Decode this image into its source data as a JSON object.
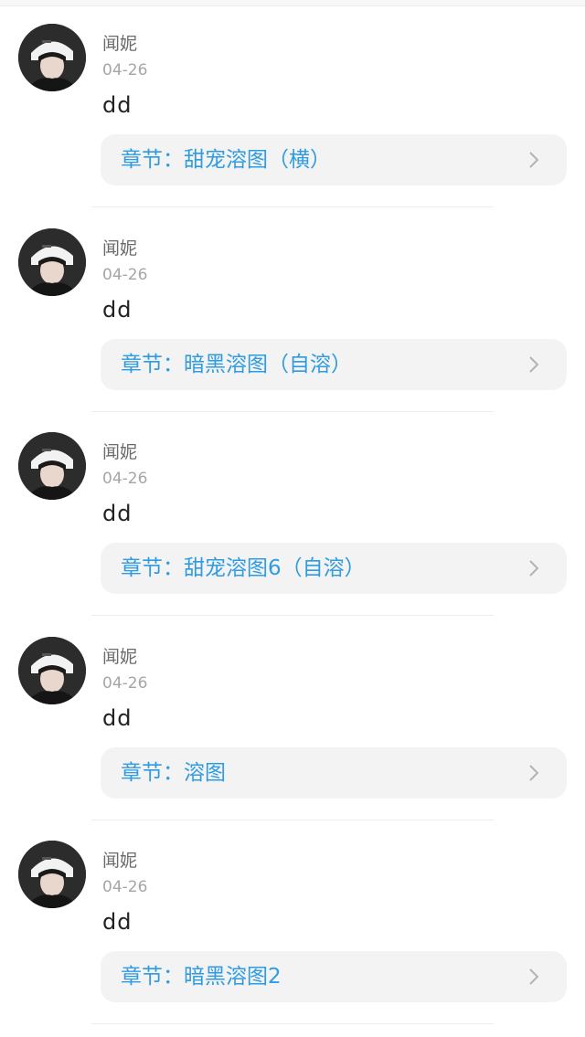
{
  "comments": [
    {
      "name": "闻妮",
      "date": "04-26",
      "content": "dd",
      "chapter_prefix": "章节：",
      "chapter": "甜宠溶图（横）"
    },
    {
      "name": "闻妮",
      "date": "04-26",
      "content": "dd",
      "chapter_prefix": "章节：",
      "chapter": "暗黑溶图（自溶）"
    },
    {
      "name": "闻妮",
      "date": "04-26",
      "content": "dd",
      "chapter_prefix": "章节：",
      "chapter": "甜宠溶图6（自溶）"
    },
    {
      "name": "闻妮",
      "date": "04-26",
      "content": "dd",
      "chapter_prefix": "章节：",
      "chapter": "溶图"
    },
    {
      "name": "闻妮",
      "date": "04-26",
      "content": "dd",
      "chapter_prefix": "章节：",
      "chapter": "暗黑溶图2"
    }
  ],
  "colors": {
    "chapter_text": "#2f9be0",
    "chapter_bg": "#f3f3f3",
    "name": "#6b6b6b",
    "date": "#a6a6a6"
  },
  "icons": {
    "avatar": "user-avatar-photo",
    "chevron": "chevron-right-icon"
  }
}
